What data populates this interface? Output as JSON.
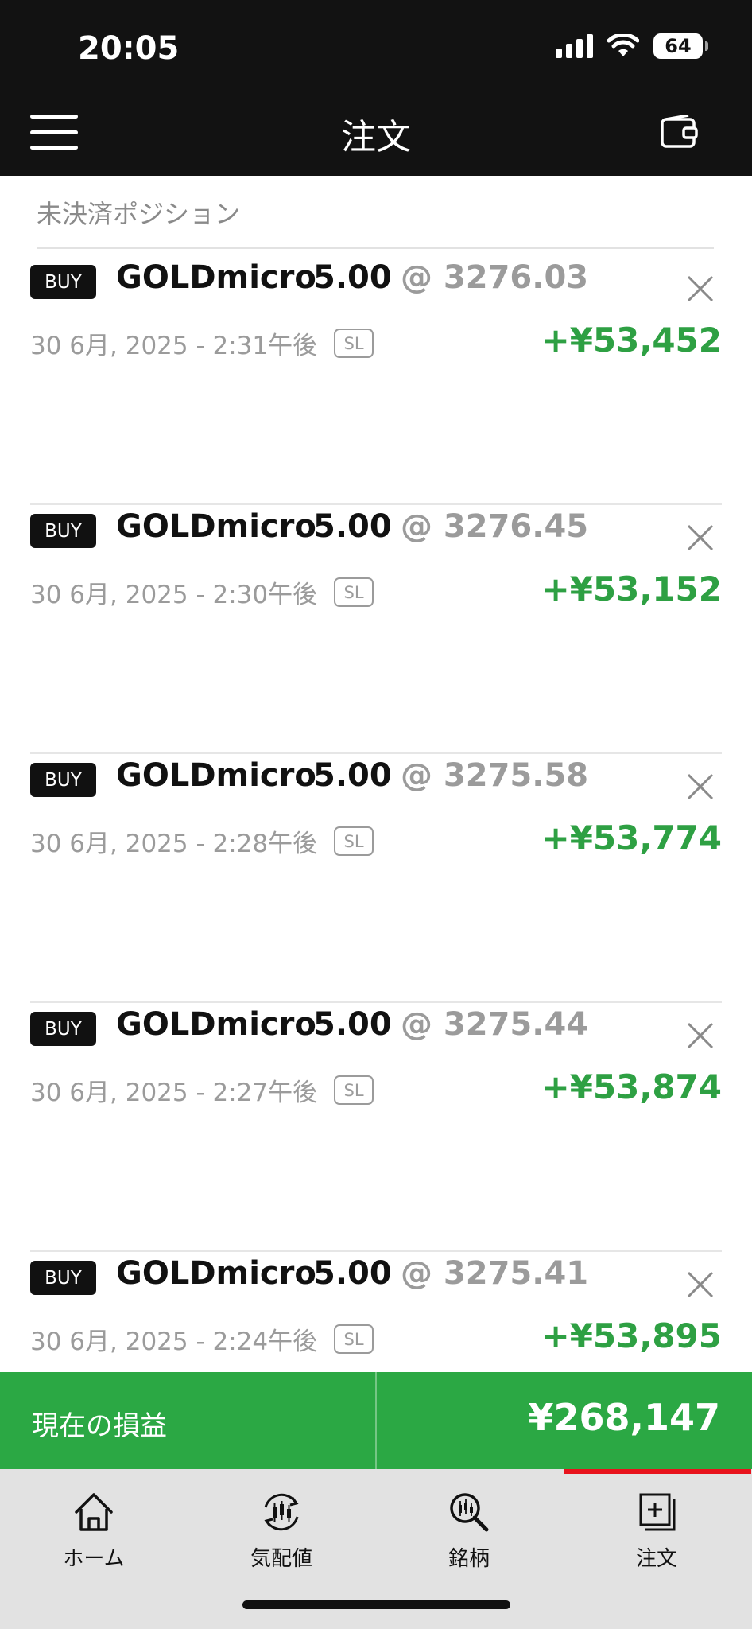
{
  "status_bar": {
    "time": "20:05",
    "battery": "64"
  },
  "header": {
    "title": "注文",
    "menu_icon": "hamburger-menu-icon",
    "wallet_icon": "wallet-icon"
  },
  "section": {
    "label": "未決済ポジション"
  },
  "positions": [
    {
      "side": "BUY",
      "symbol": "GOLDmicro",
      "lots": "5.00",
      "price": "@ 3276.03",
      "time": "30 6月, 2025 - 2:31午後",
      "sl": "SL",
      "profit": "+¥53,452"
    },
    {
      "side": "BUY",
      "symbol": "GOLDmicro",
      "lots": "5.00",
      "price": "@ 3276.45",
      "time": "30 6月, 2025 - 2:30午後",
      "sl": "SL",
      "profit": "+¥53,152"
    },
    {
      "side": "BUY",
      "symbol": "GOLDmicro",
      "lots": "5.00",
      "price": "@ 3275.58",
      "time": "30 6月, 2025 - 2:28午後",
      "sl": "SL",
      "profit": "+¥53,774"
    },
    {
      "side": "BUY",
      "symbol": "GOLDmicro",
      "lots": "5.00",
      "price": "@ 3275.44",
      "time": "30 6月, 2025 - 2:27午後",
      "sl": "SL",
      "profit": "+¥53,874"
    },
    {
      "side": "BUY",
      "symbol": "GOLDmicro",
      "lots": "5.00",
      "price": "@ 3275.41",
      "time": "30 6月, 2025 - 2:24午後",
      "sl": "SL",
      "profit": "+¥53,895"
    }
  ],
  "pl_bar": {
    "label": "現在の損益",
    "value": "¥268,147"
  },
  "tabs": [
    {
      "label": "ホーム",
      "icon": "home-icon"
    },
    {
      "label": "気配値",
      "icon": "quotes-icon"
    },
    {
      "label": "銘柄",
      "icon": "symbol-search-icon"
    },
    {
      "label": "注文",
      "icon": "order-icon",
      "active": true
    }
  ],
  "colors": {
    "profit": "#2ea043",
    "pl_bar": "#2ba844",
    "header": "#121212",
    "active_tab": "#e8131c"
  }
}
